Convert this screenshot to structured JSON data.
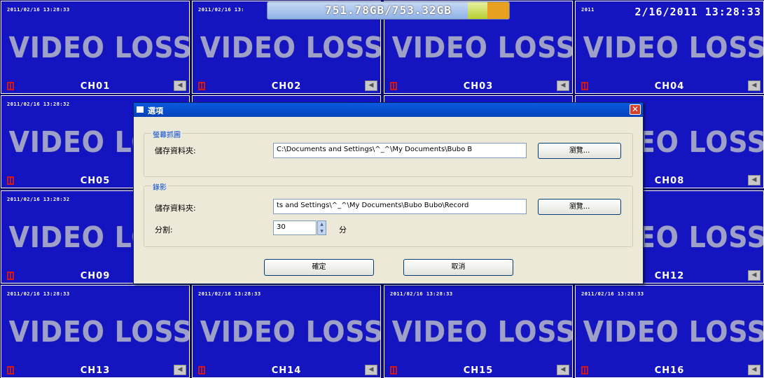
{
  "hdd_status": {
    "text": "751.78GB/753.32GB",
    "used_fraction": 0.83
  },
  "clock_overlay": "2/16/2011 13:28:33",
  "channels": [
    {
      "label": "CH01",
      "timestamp": "2011/02/16 13:28:33",
      "status": "VIDEO LOSS"
    },
    {
      "label": "CH02",
      "timestamp": "2011/02/16 13:",
      "status": "VIDEO LOSS"
    },
    {
      "label": "CH03",
      "timestamp": "",
      "status": "VIDEO LOSS"
    },
    {
      "label": "CH04",
      "timestamp": "2011",
      "status": "VIDEO LOSS"
    },
    {
      "label": "CH05",
      "timestamp": "2011/02/16 13:28:32",
      "status": "VIDEO LOSS"
    },
    {
      "label": "CH06",
      "timestamp": "",
      "status": "VIDEO LOSS"
    },
    {
      "label": "CH07",
      "timestamp": "",
      "status": "VIDEO LOSS"
    },
    {
      "label": "CH08",
      "timestamp": ":28:32",
      "status": "VIDEO LOSS"
    },
    {
      "label": "CH09",
      "timestamp": "2011/02/16 13:28:32",
      "status": "VIDEO LOSS"
    },
    {
      "label": "CH10",
      "timestamp": "",
      "status": "VIDEO LOSS"
    },
    {
      "label": "CH11",
      "timestamp": "",
      "status": "VIDEO LOSS"
    },
    {
      "label": "CH12",
      "timestamp": ":28:33",
      "status": "VIDEO LOSS"
    },
    {
      "label": "CH13",
      "timestamp": "2011/02/16 13:28:33",
      "status": "VIDEO LOSS"
    },
    {
      "label": "CH14",
      "timestamp": "2011/02/16 13:28:33",
      "status": "VIDEO LOSS"
    },
    {
      "label": "CH15",
      "timestamp": "2011/02/16 13:28:33",
      "status": "VIDEO LOSS"
    },
    {
      "label": "CH16",
      "timestamp": "2011/02/16 13:28:33",
      "status": "VIDEO LOSS"
    }
  ],
  "dialog": {
    "title": "選項",
    "snapshot_group": {
      "label": "螢幕抓圖",
      "folder_label": "儲存資料夾:",
      "folder_value": "C:\\Documents and Settings\\^_^\\My Documents\\Bubo B",
      "browse_label": "瀏覽..."
    },
    "record_group": {
      "label": "錄影",
      "folder_label": "儲存資料夾:",
      "folder_value": "ts and Settings\\^_^\\My Documents\\Bubo Bubo\\Record",
      "browse_label": "瀏覽...",
      "split_label": "分割:",
      "split_value": "30",
      "split_unit": "分"
    },
    "ok_label": "確定",
    "cancel_label": "取消"
  },
  "colors": {
    "tile_bg": "#1414c0",
    "dialog_bg": "#ece9d8",
    "titlebar": "#0a5ae0",
    "hdd_bar": "#8fb1e6",
    "hdd_end": "#e8a020"
  }
}
